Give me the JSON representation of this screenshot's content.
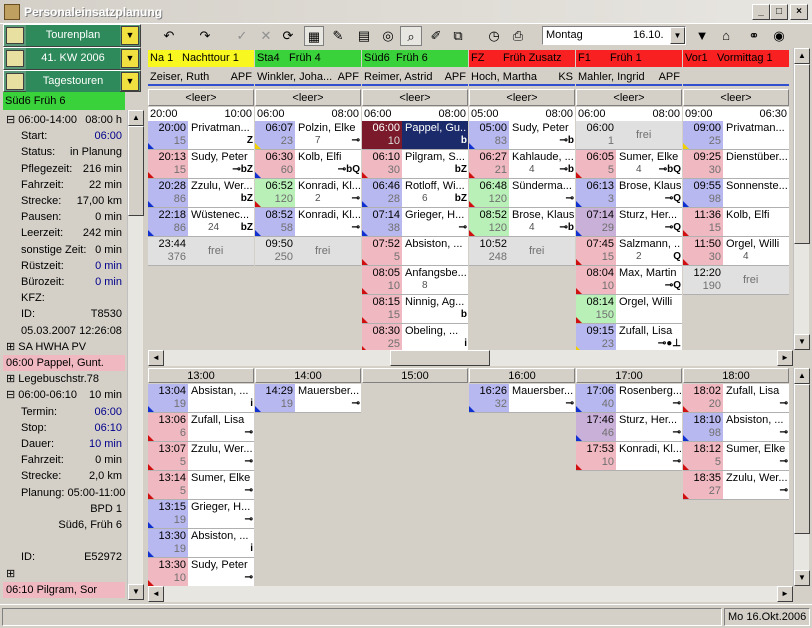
{
  "window": {
    "title": "Personaleinsatzplanung",
    "min_label": "_",
    "max_label": "□",
    "close_label": "×"
  },
  "toolbar": {
    "tourenplan": "Tourenplan",
    "week": "41. KW 2006",
    "tagestouren": "Tagestouren",
    "day_combo": "Montag",
    "date_combo": "16.10.",
    "undo": "↶",
    "redo": "↷",
    "check": "✓",
    "cross": "✕",
    "refresh": "⟳"
  },
  "colors": {
    "green": "#3ad23a",
    "yellow": "#f8f820",
    "red": "#f82020",
    "blue_time": "#b8b8f0",
    "pink_time": "#f0b8c0",
    "green_time": "#b8f0b8",
    "purple_time": "#c8b0d8",
    "dark": "#1a2a6a"
  },
  "left_panel": {
    "header": "Süd6   Früh 6",
    "rows": [
      {
        "k": "⊟ 06:00-14:00",
        "v": "08:00 h",
        "bold": false
      },
      {
        "k": "Start:",
        "v": "06:00",
        "bold": true
      },
      {
        "k": "Status:",
        "v": "in Planung",
        "bold": false
      },
      {
        "k": "Pflegezeit:",
        "v": "216 min",
        "bold": false
      },
      {
        "k": "Fahrzeit:",
        "v": "22 min",
        "bold": false
      },
      {
        "k": "Strecke:",
        "v": "17,00 km",
        "bold": false
      },
      {
        "k": "Pausen:",
        "v": "0 min",
        "bold": false
      },
      {
        "k": "Leerzeit:",
        "v": "242 min",
        "bold": false
      },
      {
        "k": "sonstige Zeit:",
        "v": "0 min",
        "bold": false
      },
      {
        "k": "Rüstzeit:",
        "v": "0 min",
        "bold": true
      },
      {
        "k": "Bürozeit:",
        "v": "0 min",
        "bold": true
      },
      {
        "k": "KFZ:",
        "v": "",
        "bold": false
      },
      {
        "k": "ID:",
        "v": "T8530",
        "bold": false
      },
      {
        "k": "05.03.2007 12:26:08",
        "v": "",
        "bold": false
      },
      {
        "k": "⊞  SA  HWHA PV",
        "v": "",
        "bold": false
      },
      {
        "k": "06:00 Pappel, Gunt.",
        "v": "",
        "bold": false
      },
      {
        "k": "⊞ Legebuschstr.78",
        "v": "",
        "bold": false
      },
      {
        "k": "⊟ 06:00-06:10",
        "v": "10 min",
        "bold": false
      },
      {
        "k": "Termin:",
        "v": "06:00",
        "bold": true
      },
      {
        "k": "Stop:",
        "v": "06:10",
        "bold": true
      },
      {
        "k": "Dauer:",
        "v": "10 min",
        "bold": true
      },
      {
        "k": "Fahrzeit:",
        "v": "0 min",
        "bold": false
      },
      {
        "k": "Strecke:",
        "v": "2,0 km",
        "bold": false
      },
      {
        "k": "Planung: 05:00-11:00",
        "v": "",
        "bold": false
      },
      {
        "k": "",
        "v": "BPD 1",
        "bold": false
      },
      {
        "k": "",
        "v": "Süd6, Früh 6",
        "bold": false
      },
      {
        "k": "",
        "v": "",
        "bold": false
      },
      {
        "k": "ID:",
        "v": "E52972",
        "bold": false
      },
      {
        "k": "⊞",
        "v": "",
        "bold": false
      },
      {
        "k": "06:10 Pilgram, Sor",
        "v": "",
        "bold": false
      }
    ]
  },
  "columns": [
    {
      "code": "Na 1",
      "shift": "Nachttour 1",
      "hcolor": "#f8f820",
      "name": "Zeiser, Ruth",
      "apf": "APF",
      "start": "20:00",
      "end": "10:00",
      "cards": [
        {
          "t1": "20:00",
          "t2": "15",
          "nm": "Privatman...",
          "n2": "",
          "ico": "Z",
          "tc": "#b8b8f0",
          "tri": "#1030d0"
        },
        {
          "t1": "20:13",
          "t2": "15",
          "nm": "Sudy, Peter",
          "n2": "",
          "ico": "⊸bZ",
          "tc": "#f0b8c0",
          "tri": "#d01010"
        },
        {
          "t1": "20:28",
          "t2": "86",
          "nm": "Zzulu, Wer...",
          "n2": "",
          "ico": "bZ",
          "tc": "#b8b8f0",
          "tri": "#1030d0"
        },
        {
          "t1": "22:18",
          "t2": "86",
          "nm": "Wüstenec...",
          "n2": "24",
          "ico": "bZ",
          "tc": "#b8b8f0",
          "tri": "#1030d0"
        }
      ],
      "free": {
        "t1": "23:44",
        "t2": "376",
        "label": "frei"
      }
    },
    {
      "code": "Sta4",
      "shift": "Früh 4",
      "hcolor": "#3ad23a",
      "name": "Winkler, Joha...",
      "apf": "APF",
      "start": "06:00",
      "end": "08:00",
      "cards": [
        {
          "t1": "06:07",
          "t2": "23",
          "nm": "Polzin, Elke",
          "n2": "7",
          "ico": "⊸",
          "tc": "#b8b8f0",
          "tri": "#f0d000"
        },
        {
          "t1": "06:30",
          "t2": "60",
          "nm": "Kolb, Elfi",
          "n2": "",
          "ico": "⊸bQ",
          "tc": "#f0b8c0",
          "tri": "#1030d0"
        },
        {
          "t1": "06:52",
          "t2": "120",
          "nm": "Konradi, Kl...",
          "n2": "2",
          "ico": "⊸",
          "tc": "#b8f0b8",
          "tri": "#d01010"
        },
        {
          "t1": "08:52",
          "t2": "58",
          "nm": "Konradi, Kl...",
          "n2": "",
          "ico": "⊸",
          "tc": "#b8b8f0",
          "tri": "#1030d0"
        }
      ],
      "free": {
        "t1": "09:50",
        "t2": "250",
        "label": "frei"
      }
    },
    {
      "code": "Süd6",
      "shift": "Früh 6",
      "hcolor": "#3ad23a",
      "name": "Reimer, Astrid",
      "apf": "APF",
      "start": "06:00",
      "end": "08:00",
      "cards": [
        {
          "t1": "06:00",
          "t2": "10",
          "nm": "Pappel, Gu...",
          "n2": "",
          "ico": "b",
          "tc": "#7a1a2a",
          "tri": "",
          "dark": true
        },
        {
          "t1": "06:10",
          "t2": "30",
          "nm": "Pilgram, S...",
          "n2": "",
          "ico": "bZ",
          "tc": "#f0b8c0",
          "tri": "#d01010"
        },
        {
          "t1": "06:46",
          "t2": "28",
          "nm": "Rotloff, Wi...",
          "n2": "6",
          "ico": "bZ",
          "tc": "#b8b8f0",
          "tri": "#1030d0"
        },
        {
          "t1": "07:14",
          "t2": "38",
          "nm": "Grieger, H...",
          "n2": "",
          "ico": "⊸",
          "tc": "#b8b8f0",
          "tri": "#1030d0"
        },
        {
          "t1": "07:52",
          "t2": "5",
          "nm": "Absiston, ...",
          "n2": "",
          "ico": "",
          "tc": "#f0b8c0",
          "tri": "#d01010"
        },
        {
          "t1": "08:05",
          "t2": "10",
          "nm": "Anfangsbe...",
          "n2": "8",
          "ico": "",
          "tc": "#f0b8c0",
          "tri": "#d01010"
        },
        {
          "t1": "08:15",
          "t2": "15",
          "nm": "Ninnig, Ag...",
          "n2": "",
          "ico": "b",
          "tc": "#f0b8c0",
          "tri": "#d01010"
        },
        {
          "t1": "08:30",
          "t2": "25",
          "nm": "Obeling, ...",
          "n2": "",
          "ico": "i",
          "tc": "#f0b8c0",
          "tri": "#d01010"
        }
      ]
    },
    {
      "code": "FZ",
      "shift": "Früh Zusatz",
      "hcolor": "#f82020",
      "name": "Hoch, Martha",
      "apf": "KS",
      "start": "05:00",
      "end": "08:00",
      "cards": [
        {
          "t1": "05:00",
          "t2": "83",
          "nm": "Sudy, Peter",
          "n2": "",
          "ico": "⊸b",
          "tc": "#b8b8f0",
          "tri": "#1030d0"
        },
        {
          "t1": "06:27",
          "t2": "21",
          "nm": "Kahlaude, ...",
          "n2": "4",
          "ico": "⊸b",
          "tc": "#f0b8c0",
          "tri": "#d01010"
        },
        {
          "t1": "06:48",
          "t2": "120",
          "nm": "Sündermа...",
          "n2": "",
          "ico": "⊸",
          "tc": "#b8f0b8",
          "tri": "#d01010"
        },
        {
          "t1": "08:52",
          "t2": "120",
          "nm": "Brose, Klaus",
          "n2": "4",
          "ico": "⊸b",
          "tc": "#b8f0b8",
          "tri": "#d01010"
        }
      ],
      "free": {
        "t1": "10:52",
        "t2": "248",
        "label": "frei"
      }
    },
    {
      "code": "F1",
      "shift": "Früh 1",
      "hcolor": "#f82020",
      "name": "Mahler, Ingrid",
      "apf": "APF",
      "start": "06:00",
      "end": "08:00",
      "cards": [
        {
          "t1": "06:00",
          "t2": "1",
          "nm": "",
          "n2": "",
          "ico": "",
          "tc": "#e0e0e0",
          "tri": "",
          "freecard": true
        },
        {
          "t1": "06:05",
          "t2": "5",
          "nm": "Sumer, Elke",
          "n2": "4",
          "ico": "⊸bQ",
          "tc": "#f0b8c0",
          "tri": "#d01010"
        },
        {
          "t1": "06:13",
          "t2": "3",
          "nm": "Brose, Klaus",
          "n2": "",
          "ico": "⊸Q",
          "tc": "#b8b8f0",
          "tri": "#1030d0"
        },
        {
          "t1": "07:14",
          "t2": "29",
          "nm": "Sturz, Her...",
          "n2": "",
          "ico": "⊸Q",
          "tc": "#c8b0d8",
          "tri": "#1030d0"
        },
        {
          "t1": "07:45",
          "t2": "15",
          "nm": "Salzmann, ...",
          "n2": "2",
          "ico": "Q",
          "tc": "#f0b8c0",
          "tri": "#d01010"
        },
        {
          "t1": "08:04",
          "t2": "10",
          "nm": "Max, Martin",
          "n2": "",
          "ico": "⊸Q",
          "tc": "#f0b8c0",
          "tri": "#d01010"
        },
        {
          "t1": "08:14",
          "t2": "150",
          "nm": "Orgel, Willi",
          "n2": "",
          "ico": "",
          "tc": "#b8f0b8",
          "tri": "#d01010"
        },
        {
          "t1": "09:15",
          "t2": "23",
          "nm": "Zufall, Lisa",
          "n2": "",
          "ico": "⊸●⊥",
          "tc": "#b8b8f0",
          "tri": "#f0d000"
        }
      ]
    },
    {
      "code": "Vor1",
      "shift": "Vormittag 1",
      "hcolor": "#f82020",
      "name": "",
      "apf": "",
      "start": "09:00",
      "end": "06:30",
      "cards": [
        {
          "t1": "09:00",
          "t2": "25",
          "nm": "Privatman...",
          "n2": "",
          "ico": "",
          "tc": "#b8b8f0",
          "tri": "#f0d000"
        },
        {
          "t1": "09:25",
          "t2": "30",
          "nm": "Dienstüber...",
          "n2": "",
          "ico": "",
          "tc": "#f0b8c0",
          "tri": ""
        },
        {
          "t1": "09:55",
          "t2": "98",
          "nm": "Sonnenste...",
          "n2": "",
          "ico": "",
          "tc": "#b8b8f0",
          "tri": "#1030d0"
        },
        {
          "t1": "11:36",
          "t2": "15",
          "nm": "Kolb, Elfi",
          "n2": "",
          "ico": "",
          "tc": "#f0b8c0",
          "tri": "#d01010"
        },
        {
          "t1": "11:50",
          "t2": "30",
          "nm": "Orgel, Willi",
          "n2": "4",
          "ico": "",
          "tc": "#f0b8c0",
          "tri": "#d01010"
        }
      ],
      "free": {
        "t1": "12:20",
        "t2": "190",
        "label": "frei"
      }
    }
  ],
  "bottom": {
    "hours": [
      "13:00",
      "14:00",
      "15:00",
      "16:00",
      "17:00",
      "18:00"
    ],
    "cols": [
      [
        {
          "t1": "13:04",
          "t2": "19",
          "nm": "Absistan, ...",
          "ico": "i",
          "tc": "#b8b8f0",
          "tri": "#1030d0"
        },
        {
          "t1": "13:06",
          "t2": "6",
          "nm": "Zufall, Lisa",
          "ico": "⊸",
          "tc": "#f0b8c0",
          "tri": "#d01010"
        },
        {
          "t1": "13:07",
          "t2": "5",
          "nm": "Zzulu, Wer...",
          "ico": "⊸",
          "tc": "#f0b8c0",
          "tri": "#d01010"
        },
        {
          "t1": "13:14",
          "t2": "5",
          "nm": "Sumer, Elke",
          "ico": "⊸",
          "tc": "#f0b8c0",
          "tri": "#d01010"
        },
        {
          "t1": "13:15",
          "t2": "19",
          "nm": "Grieger, H...",
          "ico": "⊸",
          "tc": "#b8b8f0",
          "tri": "#1030d0"
        },
        {
          "t1": "13:30",
          "t2": "19",
          "nm": "Absiston, ...",
          "ico": "i",
          "tc": "#b8b8f0",
          "tri": "#1030d0"
        },
        {
          "t1": "13:30",
          "t2": "10",
          "nm": "Sudy, Peter",
          "ico": "⊸",
          "tc": "#f0b8c0",
          "tri": "#d01010"
        }
      ],
      [
        {
          "t1": "14:29",
          "t2": "19",
          "nm": "Mauersber...",
          "ico": "⊸",
          "tc": "#b8b8f0",
          "tri": "#1030d0"
        }
      ],
      [],
      [
        {
          "t1": "16:26",
          "t2": "32",
          "nm": "Mauersber...",
          "ico": "⊸",
          "tc": "#b8b8f0",
          "tri": "#1030d0"
        }
      ],
      [
        {
          "t1": "17:06",
          "t2": "40",
          "nm": "Rosenberg...",
          "ico": "⊸",
          "tc": "#b8b8f0",
          "tri": "#1030d0"
        },
        {
          "t1": "17:46",
          "t2": "46",
          "nm": "Sturz, Her...",
          "ico": "⊸",
          "tc": "#c8b0d8",
          "tri": "#1030d0"
        },
        {
          "t1": "17:53",
          "t2": "10",
          "nm": "Konradi, Kl...",
          "ico": "⊸",
          "tc": "#f0b8c0",
          "tri": "#d01010"
        }
      ],
      [
        {
          "t1": "18:02",
          "t2": "20",
          "nm": "Zufall, Lisa",
          "ico": "⊸",
          "tc": "#f0b8c0",
          "tri": "#d01010"
        },
        {
          "t1": "18:10",
          "t2": "98",
          "nm": "Absiston, ...",
          "ico": "⊸",
          "tc": "#b8b8f0",
          "tri": "#1030d0"
        },
        {
          "t1": "18:12",
          "t2": "5",
          "nm": "Sumer, Elke",
          "ico": "⊸",
          "tc": "#f0b8c0",
          "tri": "#d01010"
        },
        {
          "t1": "18:35",
          "t2": "27",
          "nm": "Zzulu, Wer...",
          "ico": "⊸",
          "tc": "#f0b8c0",
          "tri": "#d01010"
        }
      ]
    ]
  },
  "leer_label": "<leer>",
  "status": {
    "date": "Mo 16.Okt.2006"
  }
}
